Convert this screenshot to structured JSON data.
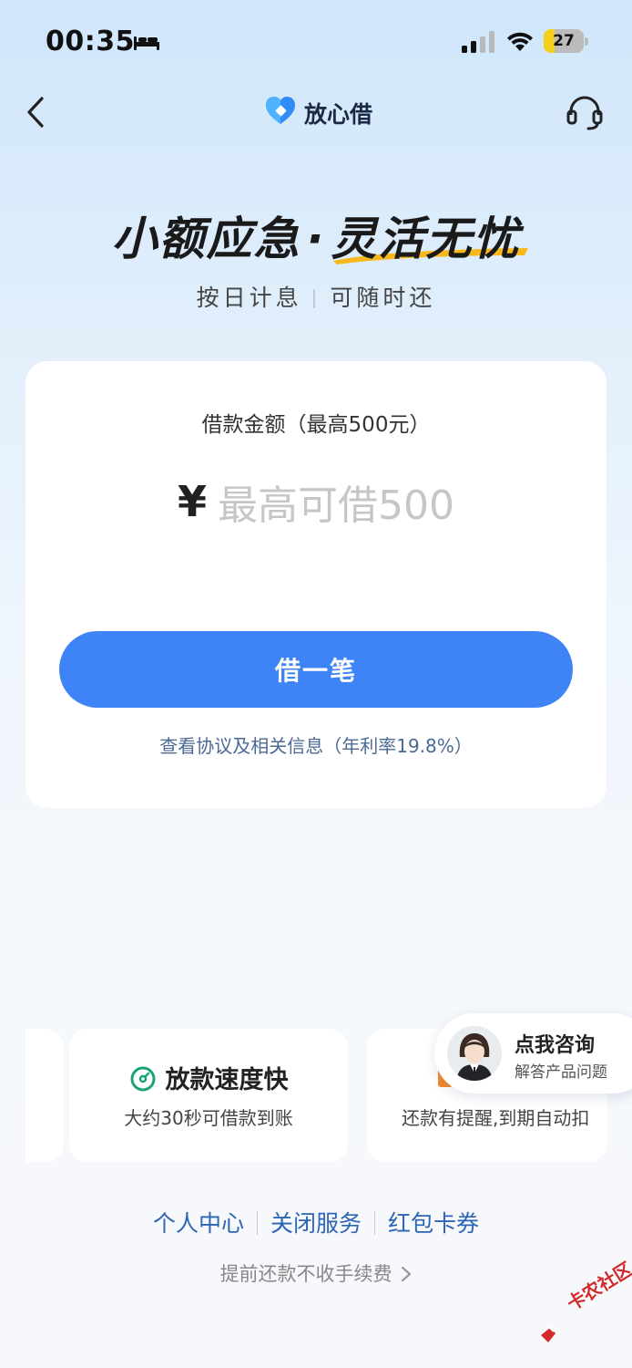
{
  "status_bar": {
    "time": "00:35",
    "battery": "27",
    "battery_level": 0.27
  },
  "header": {
    "brand": "放心借"
  },
  "hero": {
    "title_left": "小额应急",
    "title_dot": "·",
    "title_right": "灵活无忧",
    "sub_left": "按日计息",
    "sub_sep": "|",
    "sub_right": "可随时还"
  },
  "loan_card": {
    "amount_label": "借款金额（最高500元）",
    "currency_symbol": "¥",
    "amount_placeholder": "最高可借500",
    "borrow_button": "借一笔",
    "agreement_link": "查看协议及相关信息（年利率19.8%）"
  },
  "features": [
    {
      "title": "放款速度快",
      "desc": "大约30秒可借款到账"
    },
    {
      "desc": "还款有提醒,到期自动扣"
    }
  ],
  "consult": {
    "title": "点我咨询",
    "subtitle": "解答产品问题"
  },
  "bottom_links": [
    "个人中心",
    "关闭服务",
    "红包卡券"
  ],
  "prepay_text": "提前还款不收手续费",
  "watermark": "卡农社区",
  "colors": {
    "primary": "#3f84f7",
    "link": "#2d65b5",
    "accent_green": "#1aa37a",
    "accent_yellow": "#f8b81c"
  }
}
